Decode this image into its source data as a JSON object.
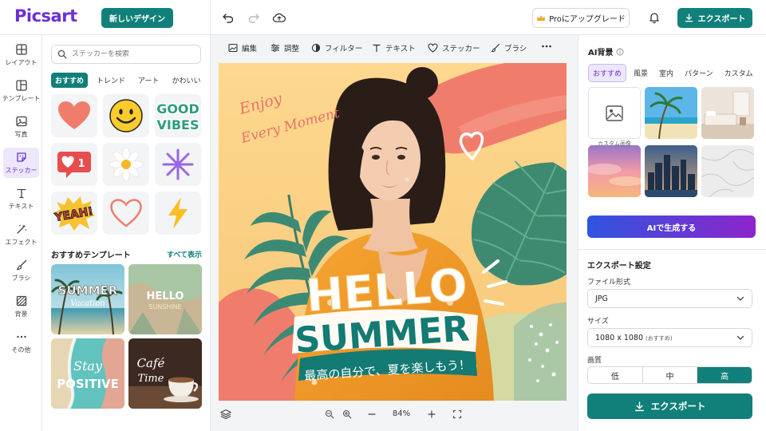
{
  "app": {
    "logo": "Picsart",
    "new_design": "新しいデザイン",
    "pro_upgrade": "Proにアップグレード",
    "export": "エクスポート"
  },
  "rail": [
    {
      "label": "レイアウト",
      "icon": "layout-icon",
      "active": false
    },
    {
      "label": "テンプレート",
      "icon": "template-icon",
      "active": false
    },
    {
      "label": "写真",
      "icon": "photo-icon",
      "active": false
    },
    {
      "label": "ステッカー",
      "icon": "sticker-icon",
      "active": true
    },
    {
      "label": "テキスト",
      "icon": "text-icon",
      "active": false
    },
    {
      "label": "エフェクト",
      "icon": "effect-icon",
      "active": false
    },
    {
      "label": "ブラシ",
      "icon": "brush-icon",
      "active": false
    },
    {
      "label": "背景",
      "icon": "background-icon",
      "active": false
    },
    {
      "label": "その他",
      "icon": "more-icon",
      "active": false
    }
  ],
  "panel": {
    "search_placeholder": "ステッカーを検索",
    "tabs": [
      "おすすめ",
      "トレンド",
      "アート",
      "かわいい"
    ],
    "stickers": {
      "good_vibes_1": "GOOD",
      "good_vibes_2": "VIBES",
      "like_count": "1",
      "yeah": "YEAH!"
    },
    "templates_title": "おすすめテンプレート",
    "templates_all": "すべて表示",
    "templates": [
      {
        "line1": "SUMMER",
        "line2": "Vacation"
      },
      {
        "line1": "HELLO",
        "line2": "SUNSHINE"
      },
      {
        "line1": "Stay",
        "line2": "POSITIVE"
      },
      {
        "line1": "Café",
        "line2": "Time"
      }
    ]
  },
  "toolbar": {
    "tools": [
      "編集",
      "調整",
      "フィルター",
      "テキスト",
      "ステッカー",
      "ブラシ"
    ]
  },
  "canvas": {
    "script_1": "Enjoy",
    "script_2": "Every Moment",
    "hello": "HELLO",
    "summer": "SUMMER",
    "tagline": "最高の自分で、夏を楽しもう！",
    "zoom": "84%"
  },
  "right": {
    "ai_bg_title": "AI背景",
    "bg_tabs": [
      "おすすめ",
      "風景",
      "室内",
      "パターン",
      "カスタム"
    ],
    "custom_image": "カスタム画像",
    "generate": "AIで生成する",
    "export_settings": "エクスポート設定",
    "file_format_label": "ファイル形式",
    "file_format": "JPG",
    "size_label": "サイズ",
    "size_value": "1080 x 1080",
    "size_note": "(おすすめ)",
    "quality_label": "画質",
    "quality": [
      "低",
      "中",
      "高"
    ],
    "quality_selected": "高",
    "export_big": "エクスポート"
  },
  "colors": {
    "teal": "#11807a",
    "purple": "#6b2fd6",
    "coral": "#f07d6c",
    "yellow": "#fcd689",
    "leaf": "#3c8a74"
  }
}
